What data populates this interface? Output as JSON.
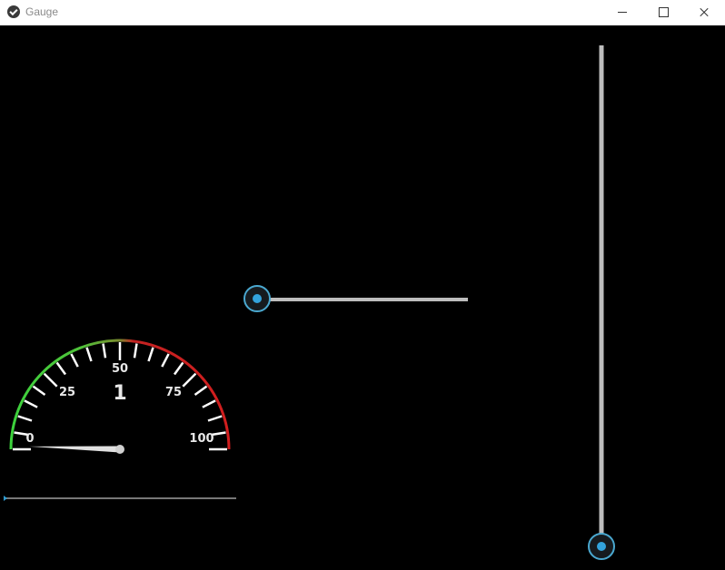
{
  "window": {
    "title": "Gauge",
    "app_icon": "kivy-icon",
    "controls": [
      "minimize",
      "maximize",
      "close"
    ]
  },
  "gauge": {
    "value": 1,
    "min": 0,
    "max": 100,
    "display_value": "1",
    "labels": [
      "0",
      "25",
      "50",
      "75",
      "100"
    ],
    "colors": {
      "low": "#3cd23c",
      "high": "#d21e1e",
      "ticks": "#ffffff",
      "needle": "#e0e0e0"
    }
  },
  "gauge_slider": {
    "value_fraction": 0.0,
    "color": "#777777",
    "accent": "#2f9bd0"
  },
  "horizontal_slider": {
    "value_fraction": 0.0,
    "track_color": "#bdbdbd",
    "accent": "#33a3dc"
  },
  "vertical_slider": {
    "value_fraction": 0.0,
    "track_color": "#bdbdbd",
    "accent": "#33a3dc"
  }
}
